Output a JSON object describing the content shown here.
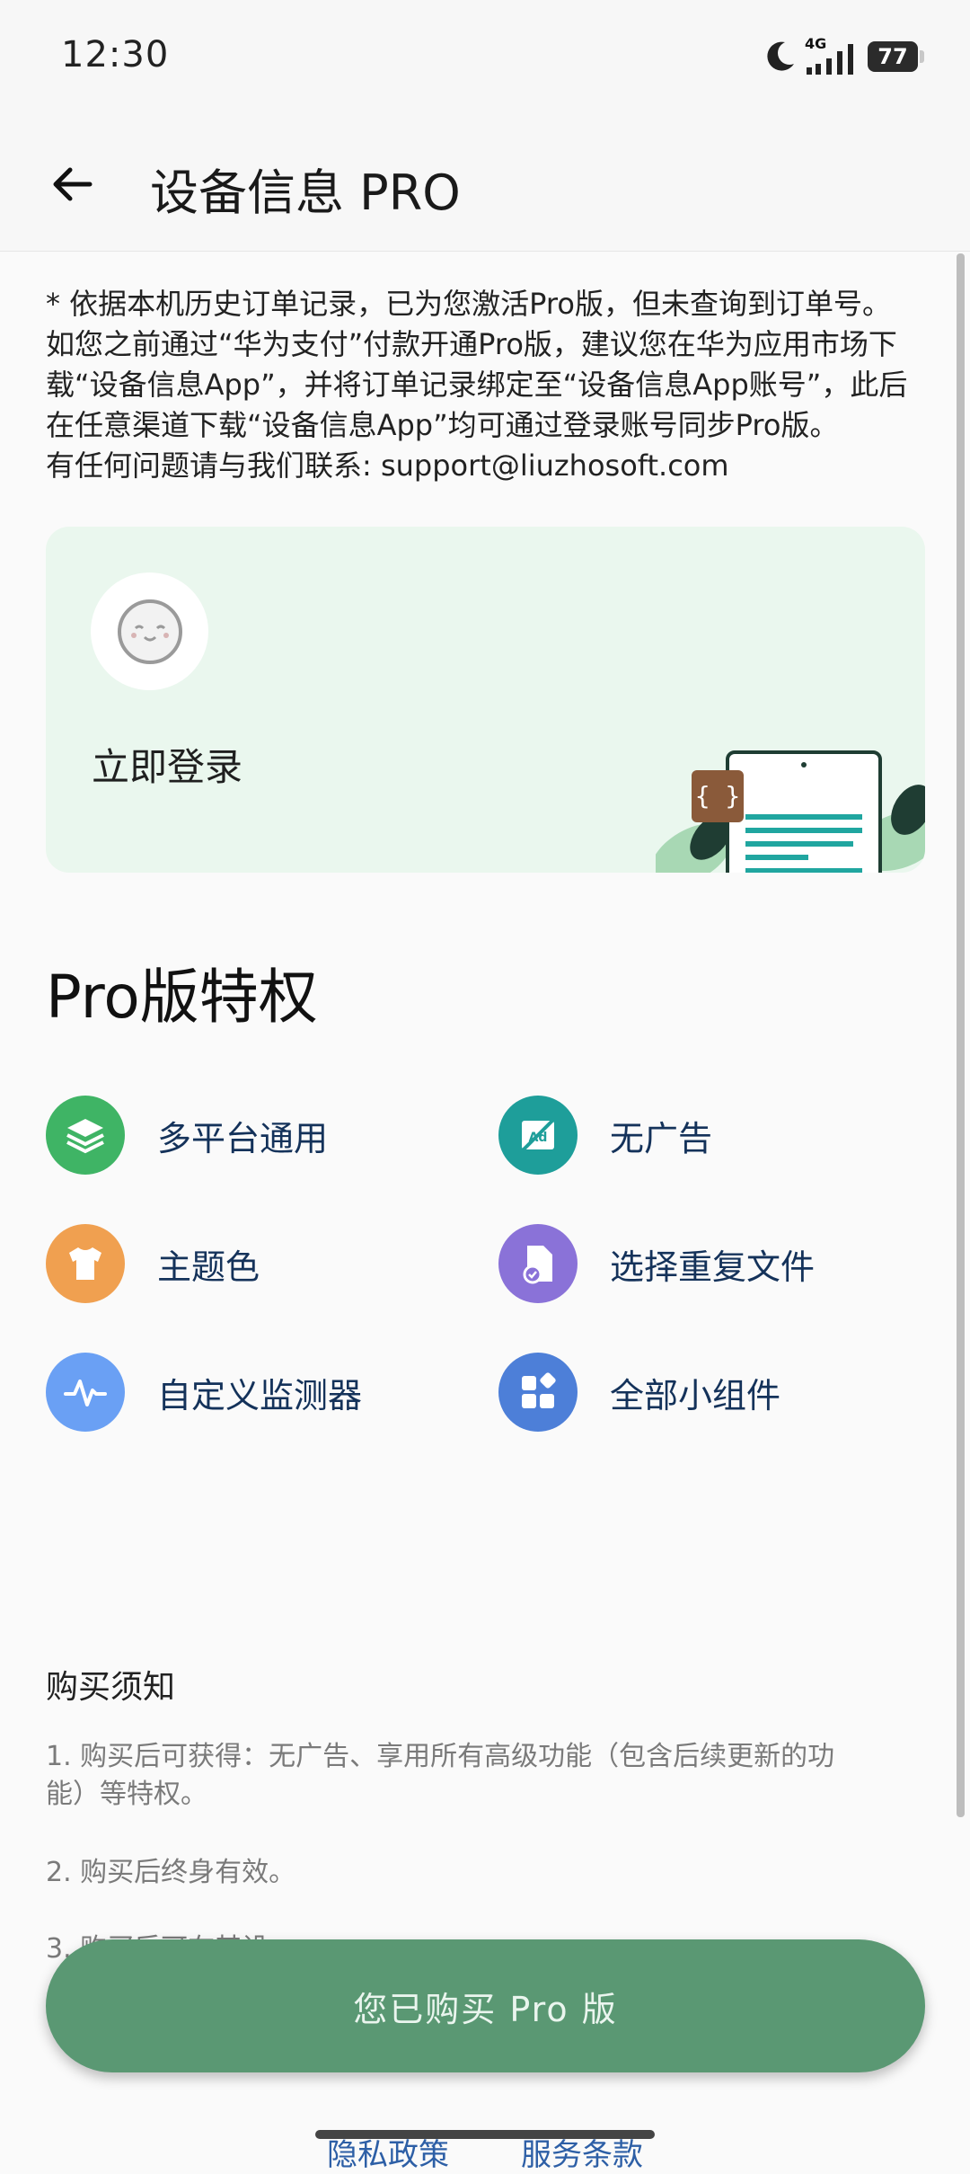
{
  "status_bar": {
    "time": "12:30",
    "network": "4G",
    "battery": "77",
    "icons": [
      "moon-icon",
      "signal-icon",
      "battery-icon"
    ]
  },
  "app_bar": {
    "title": "设备信息 PRO",
    "back_icon": "arrow-left-icon"
  },
  "notice": {
    "line1": "* 依据本机历史订单记录，已为您激活Pro版，但未查询到订单号。",
    "line2": "如您之前通过“华为支付”付款开通Pro版，建议您在华为应用市场下",
    "line3": "载“设备信息App”，并将订单记录绑定至“设备信息App账号”，此后",
    "line4": "在任意渠道下载“设备信息App”均可通过登录账号同步Pro版。",
    "line5": "有任何问题请与我们联系: support@liuzhosoft.com"
  },
  "login_card": {
    "label": "立即登录",
    "background": "#eaf7ee"
  },
  "pro_section": {
    "title": "Pro版特权",
    "features": [
      {
        "label": "多平台通用",
        "icon": "layers-icon",
        "color": "#3fb465"
      },
      {
        "label": "无广告",
        "icon": "no-ads-icon",
        "color": "#1e9e9a"
      },
      {
        "label": "主题色",
        "icon": "shirt-icon",
        "color": "#f0a050"
      },
      {
        "label": "选择重复文件",
        "icon": "file-check-icon",
        "color": "#8a72d8"
      },
      {
        "label": "自定义监测器",
        "icon": "pulse-icon",
        "color": "#6aa0f4"
      },
      {
        "label": "全部小组件",
        "icon": "widgets-icon",
        "color": "#4d7fd8"
      }
    ]
  },
  "purchase_notes": {
    "title": "购买须知",
    "item1_line1": "1. 购买后可获得：无广告、享用所有高级功能（包含后续更新的功",
    "item1_line2": "能）等特权。",
    "item2": "2. 购买后终身有效。",
    "item3_partial": "3. 购买后可在其设..."
  },
  "buy_button": {
    "label": "您已购买 Pro 版",
    "color": "#5a9873"
  },
  "footer": {
    "privacy": "隐私政策",
    "terms": "服务条款"
  }
}
